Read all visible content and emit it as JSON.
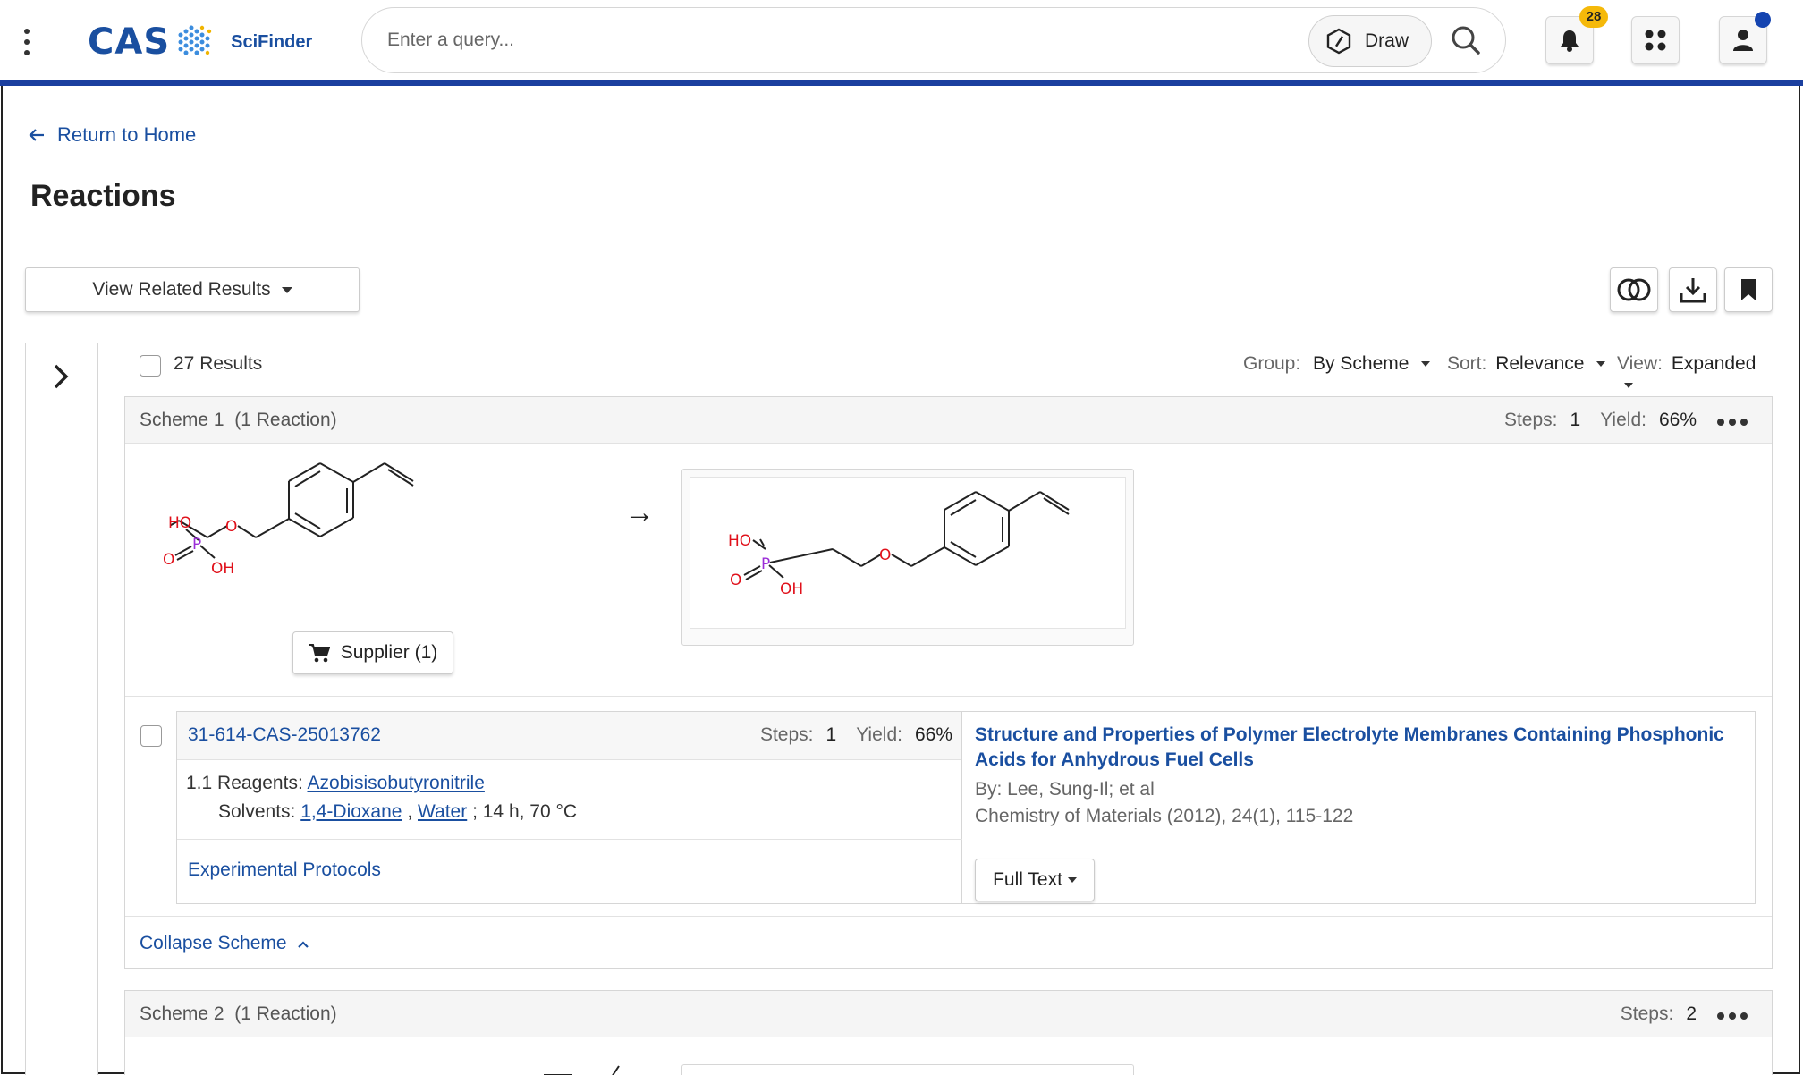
{
  "header": {
    "logo_cas": "CAS",
    "logo_product": "SciFinder",
    "search_placeholder": "Enter a query...",
    "draw_label": "Draw",
    "notification_count": "28"
  },
  "page": {
    "return_label": "Return to Home",
    "title": "Reactions",
    "related_label": "View Related Results"
  },
  "results": {
    "count_label": "27 Results",
    "group_label": "Group:",
    "group_value": "By Scheme",
    "sort_label": "Sort:",
    "sort_value": "Relevance",
    "view_label": "View:",
    "view_value": "Expanded"
  },
  "scheme1": {
    "title": "Scheme 1",
    "reaction_count": "(1 Reaction)",
    "steps_label": "Steps:",
    "steps_value": "1",
    "yield_label": "Yield:",
    "yield_value": "66%",
    "supplier_label": "Supplier (1)",
    "reaction": {
      "id": "31-614-CAS-25013762",
      "steps_label": "Steps:",
      "steps_value": "1",
      "yield_label": "Yield:",
      "yield_value": "66%",
      "step_num": "1.1",
      "reagents_label": "Reagents:",
      "reagent_1": "Azobisisobutyronitrile",
      "solvents_label": "Solvents:",
      "solvent_1": "1,4-Dioxane",
      "solvent_sep": ",",
      "solvent_2": "Water",
      "conditions": "; 14 h, 70 °C",
      "protocols_label": "Experimental Protocols",
      "ref_title": "Structure and Properties of Polymer Electrolyte Membranes Containing Phosphonic Acids for Anhydrous Fuel Cells",
      "ref_by": "By: Lee, Sung-Il; et al",
      "ref_journal": "Chemistry of Materials (2012), 24(1), 115-122",
      "fulltext_label": "Full Text"
    },
    "collapse_label": "Collapse Scheme"
  },
  "scheme2": {
    "title": "Scheme 2",
    "reaction_count": "(1 Reaction)",
    "steps_label": "Steps:",
    "steps_value": "2"
  },
  "molecule": {
    "atom_ho": "HO",
    "atom_p": "P",
    "atom_o_double": "O",
    "atom_oh": "OH",
    "atom_o_ether": "O"
  },
  "colors": {
    "brand_blue": "#1a4fa0",
    "header_rule": "#1b3f9f",
    "badge": "#f5b90a",
    "oxygen": "#e0101a",
    "phosphorus": "#9b2dd8"
  }
}
